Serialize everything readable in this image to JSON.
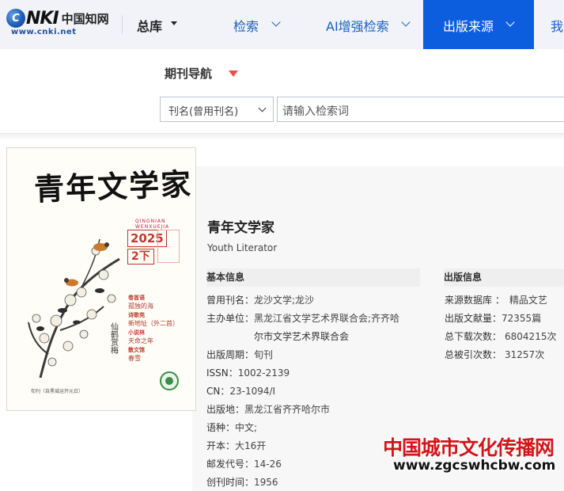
{
  "header": {
    "logo_brand": "CNKI",
    "logo_cn": "中国知网",
    "logo_url": "www.cnki.net",
    "db_selector": "总库",
    "nav": [
      "检索",
      "AI增强检索"
    ],
    "nav_active": "出版来源",
    "nav_partial": "我"
  },
  "search": {
    "section_title": "期刊导航",
    "field_selected": "刊名(曾用刊名)",
    "placeholder": "请输入检索词"
  },
  "cover": {
    "title": "青年文学家",
    "pinyin": "QINGNIAN WENXUEJIA",
    "year": "2025",
    "issue": "2下",
    "contents": [
      {
        "head": "卷首语",
        "text": "孤独的海"
      },
      {
        "head": "诗歌苑",
        "text": "新地址（外二首）"
      },
      {
        "head": "小说林",
        "text": "天命之年"
      },
      {
        "head": "散文馆",
        "text": "春雪"
      }
    ],
    "footer": "旬刊（自黑城运开元日）"
  },
  "journal": {
    "title": "青年文学家",
    "english": "Youth Literator"
  },
  "basic_info": {
    "heading": "基本信息",
    "former_name_k": "曾用刊名：",
    "former_name_v": "龙沙文学;龙沙",
    "sponsor_k": "主办单位：",
    "sponsor_v1": "黑龙江省文学艺术界联合会;齐齐哈",
    "sponsor_v2": "尔市文学艺术界联合会",
    "cycle_k": "出版周期：",
    "cycle_v": "旬刊",
    "issn_k": "ISSN：",
    "issn_v": "1002-2139",
    "cn_k": "CN：",
    "cn_v": "23-1094/I",
    "place_k": "出版地：",
    "place_v": "黑龙江省齐齐哈尔市",
    "lang_k": "语种：",
    "lang_v": "中文;",
    "format_k": "开本：",
    "format_v": "大16开",
    "postal_k": "邮发代号：",
    "postal_v": "14-26",
    "founded_k": "创刊时间：",
    "founded_v": "1956"
  },
  "pub_info": {
    "heading": "出版信息",
    "source_k": "来源数据库 ：",
    "source_v": "精品文艺",
    "volume_k": "出版文献量：",
    "volume_v": "72355篇",
    "downloads_k": "总下载次数：",
    "downloads_v": "6804215次",
    "cited_k": "总被引次数：",
    "cited_v": "31257次"
  },
  "watermark": {
    "cn": "中国城市文化传播网",
    "url": "www.zgcswhcbw.com"
  },
  "colors": {
    "nav_active_bg": "#0d5ddf",
    "link_blue": "#1a5fc5",
    "accent_red": "#e8504a",
    "watermark_red": "#d4141a"
  }
}
